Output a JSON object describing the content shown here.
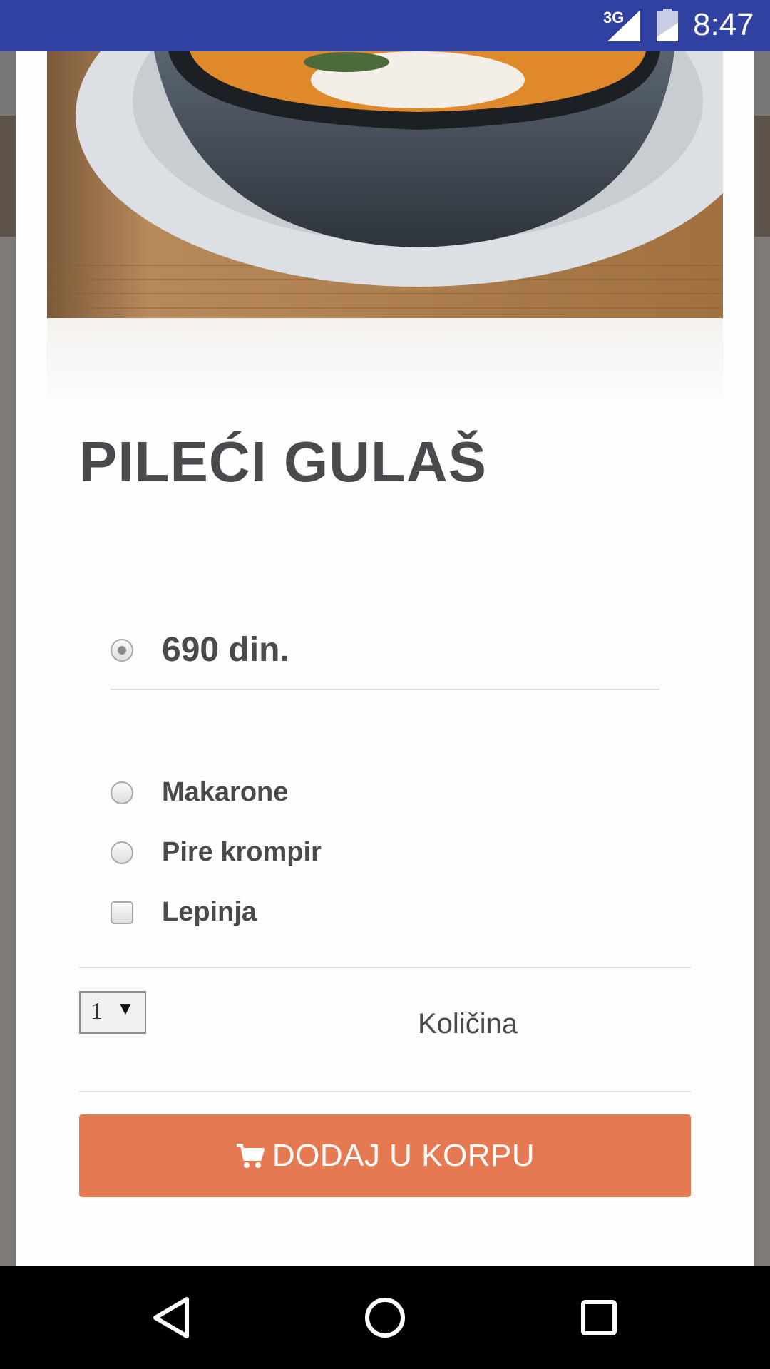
{
  "status_bar": {
    "network": "3G",
    "time": "8:47"
  },
  "product": {
    "title": "PILEĆI GULAŠ",
    "price_option": {
      "label": "690 din.",
      "selected": true
    },
    "side_options": [
      {
        "label": "Makarone",
        "type": "radio",
        "selected": false
      },
      {
        "label": "Pire krompir",
        "type": "radio",
        "selected": false
      },
      {
        "label": "Lepinja",
        "type": "checkbox",
        "checked": false
      }
    ]
  },
  "quantity": {
    "selected_value": "1",
    "label": "Količina"
  },
  "add_to_cart": {
    "label": "DODAJ U KORPU",
    "color": "#e57a52",
    "icon": "cart-icon"
  },
  "colors": {
    "status_bar": "#3041a1",
    "title_text": "#4a4a4e"
  },
  "nav_bar": {
    "icons": [
      "back-icon",
      "home-icon",
      "recents-icon"
    ]
  }
}
